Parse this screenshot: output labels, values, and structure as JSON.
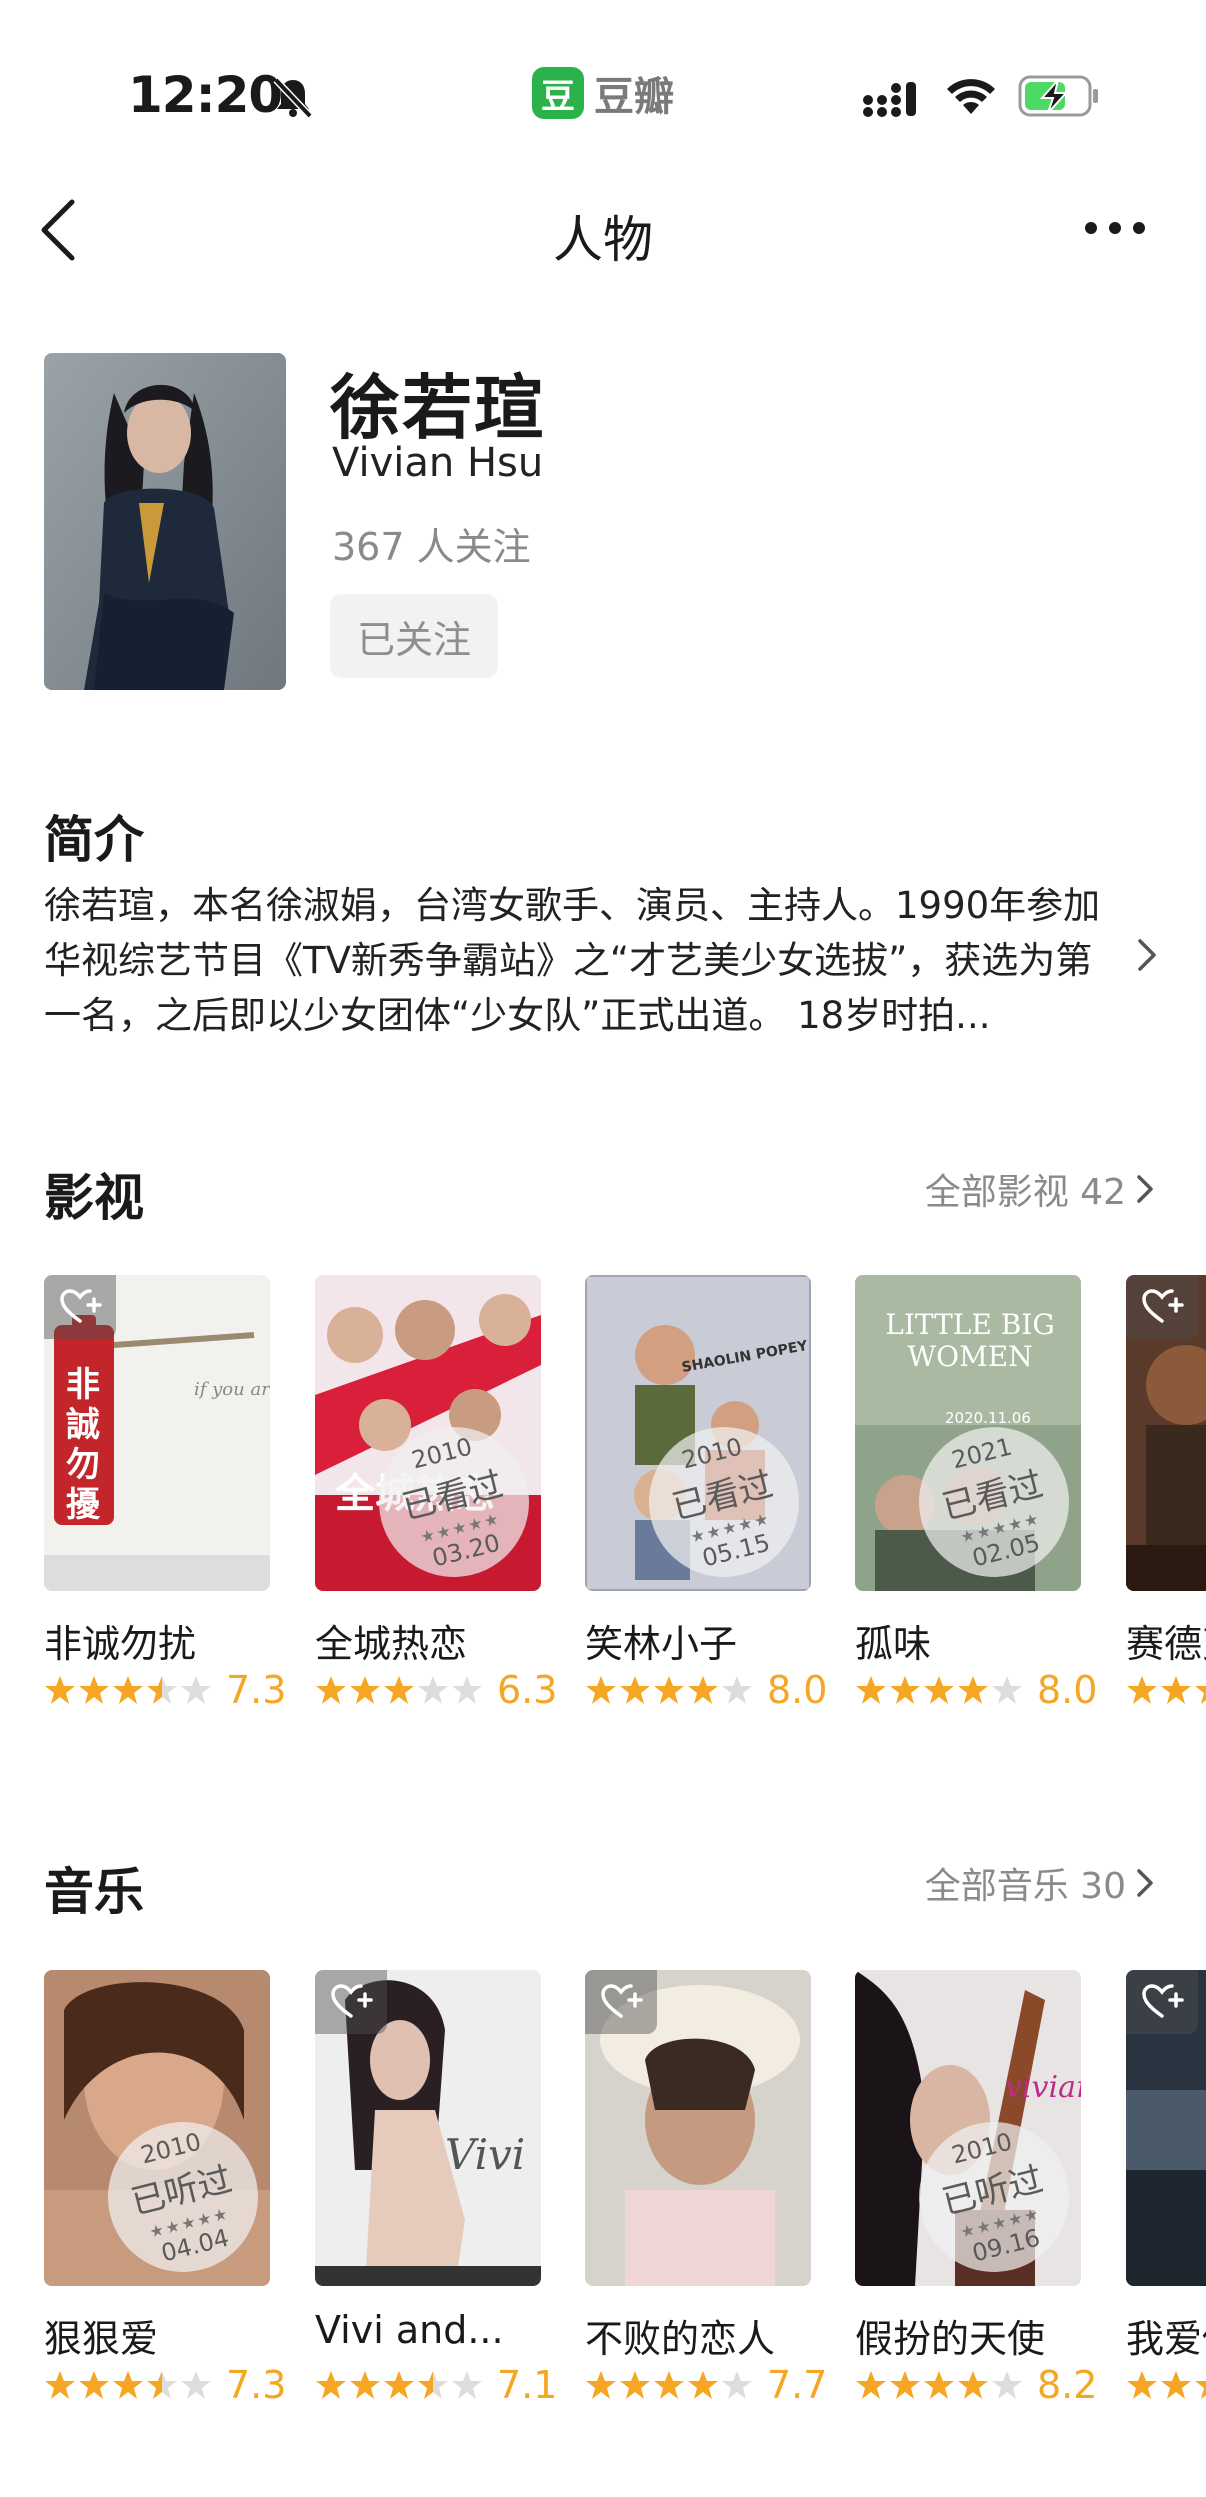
{
  "status_bar": {
    "time": "12:20",
    "app_logo": "豆",
    "app_name": "豆瓣"
  },
  "nav": {
    "title": "人物"
  },
  "profile": {
    "name": "徐若瑄",
    "english_name": "Vivian Hsu",
    "followers": "367 人关注",
    "follow_button": "已关注"
  },
  "intro": {
    "title": "简介",
    "text": "徐若瑄，本名徐淑娟，台湾女歌手、演员、主持人。1990年参加华视综艺节目《TV新秀争霸站》之“才艺美少女选拔”，获选为第一名，之后即以少女团体“少女队”正式出道。 18岁时拍..."
  },
  "films": {
    "title": "影视",
    "more": "全部影视 42",
    "items": [
      {
        "title": "非诚勿扰",
        "score": "7.3",
        "stars": 3.5,
        "wish_icon": true,
        "poster_text": "非誠勿擾"
      },
      {
        "title": "全城热恋",
        "score": "6.3",
        "stars": 3,
        "stamp": {
          "year": "2010",
          "label": "已看过",
          "date": "03.20"
        },
        "poster_text": "全城热恋"
      },
      {
        "title": "笑林小子",
        "score": "8.0",
        "stars": 4,
        "stamp": {
          "year": "2010",
          "label": "已看过",
          "date": "05.15"
        },
        "poster_text": "SHAOLIN POPEY"
      },
      {
        "title": "孤味",
        "score": "8.0",
        "stars": 4,
        "stamp": {
          "year": "2021",
          "label": "已看过",
          "date": "02.05"
        },
        "poster_text": "LITTLE BIG WOMEN",
        "poster_date": "2020.11.06"
      },
      {
        "title": "赛德克",
        "score": "",
        "stars": 3.5,
        "wish_icon": true,
        "poster_text": ""
      }
    ]
  },
  "music": {
    "title": "音乐",
    "more": "全部音乐 30",
    "items": [
      {
        "title": "狠狠爱",
        "score": "7.3",
        "stars": 3.5,
        "stamp": {
          "year": "2010",
          "label": "已听过",
          "date": "04.04"
        }
      },
      {
        "title": "Vivi and...",
        "score": "7.1",
        "stars": 3.5,
        "wish_icon": true,
        "poster_text": "Vivi"
      },
      {
        "title": "不败的恋人",
        "score": "7.7",
        "stars": 4,
        "wish_icon": true
      },
      {
        "title": "假扮的天使",
        "score": "8.2",
        "stars": 4,
        "stamp": {
          "year": "2010",
          "label": "已听过",
          "date": "09.16"
        },
        "poster_text": "vivian"
      },
      {
        "title": "我爱你",
        "score": "",
        "stars": 3.5,
        "wish_icon": true
      }
    ]
  },
  "colors": {
    "brand": "#2bb24c",
    "star": "#f5a623",
    "star_empty": "#dddddd",
    "muted": "#8a8a8a"
  }
}
